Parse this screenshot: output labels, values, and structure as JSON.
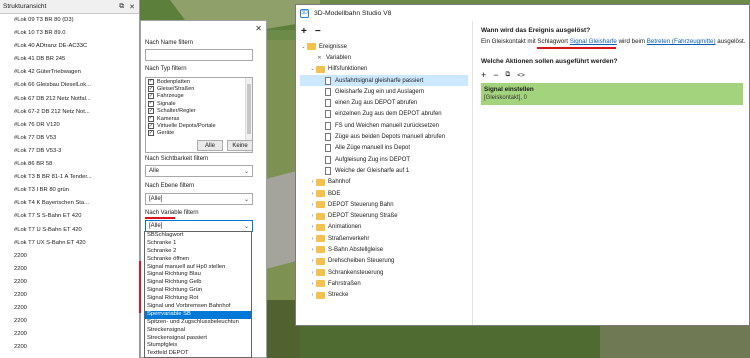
{
  "struct": {
    "title": "Strukturansicht",
    "items": [
      "#Lok 09 T3 BR 80 (D3)",
      "#Lok 10 T3 BR 89.0",
      "#Lok 40 ADtranz DE-AC33C",
      "#Lok 41 DB BR 245",
      "#Lok 42 GüterTriebwagen",
      "#Lok 66 Gleisbau DieselLok...",
      "#Lok 67 DB 212 Netz Notfal...",
      "#Lok 67-2 DB 212 Netz Not...",
      "#Lok 76 DR V120",
      "#Lok 77 DB V53",
      "#Lok 77 DB V53-3",
      "#Lok 86 BR 58",
      "#Lok T3 B BR 81-1 A Tender...",
      "#Lok T3 I BR 80 grün",
      "#Lok T4 K   Bayerischen Sta...",
      "#Lok T7 S S-Bahn ET 420",
      "#Lok T7 U S-Bahn ET 420",
      "#Lok T7 UX S-Bahn ET 420",
      "2200",
      "2200",
      "2200",
      "2200",
      "2200",
      "2200",
      "2200",
      "2200"
    ]
  },
  "filter": {
    "name_label": "Nach Name filtern",
    "name_value": "",
    "type_label": "Nach Typ filtern",
    "types": [
      "Bodenplatten",
      "Gleise/Straßen",
      "Fahrzeuge",
      "Signale",
      "Schalter/Regler",
      "Kameras",
      "Virtuelle Depots/Portale",
      "Geräte"
    ],
    "all_button": "Alle",
    "none_button": "Keine",
    "visibility_label": "Nach Sichtbarkeit filtern",
    "visibility_value": "Alle",
    "layer_label": "Nach Ebene filtern",
    "layer_value": "[Alle]",
    "variable_label": "Nach Variable filtern",
    "variable_value": "[Alle]",
    "variable_options": [
      "SBSchlagwort",
      "Schranke 1",
      "Schranke 2",
      "Schranke öffnen",
      "Signal manuell auf Hp0 stellen",
      "Signal Richtung Blau",
      "Signal Richtung Gelb",
      "Signal Richtung Grün",
      "Signal Richtung Rot",
      "Signal und Vorbremsen Bahnhof",
      "Sperrvariable SB",
      "Spitzen- und Zugschlussbeleuchtun",
      "Streckensignal",
      "Streckensignal passiert",
      "Stumpfgleis",
      "Textfeld DEPOT"
    ],
    "highlighted_option": "Sperrvariable SB"
  },
  "main": {
    "title": "3D-Modellbahn Studio V8",
    "tree": [
      {
        "label": "Ereignisse",
        "kind": "folder",
        "depth": 0,
        "expanded": true
      },
      {
        "label": "Variablen",
        "kind": "var",
        "depth": 1
      },
      {
        "label": "Hilfsfunktionen",
        "kind": "folder",
        "depth": 1,
        "expanded": true
      },
      {
        "label": "Ausfahrtsignal gleisharfe passiert",
        "kind": "doc",
        "depth": 2,
        "selected": true
      },
      {
        "label": "Gleisharfe Zug ein und Auslagern",
        "kind": "doc",
        "depth": 2
      },
      {
        "label": "einen Zug aus DEPOT abrufen",
        "kind": "doc",
        "depth": 2
      },
      {
        "label": "einzelnen Zug aus dem DEPOT abrufen",
        "kind": "doc",
        "depth": 2
      },
      {
        "label": "FS und Weichen manuell zurücksetzen",
        "kind": "doc",
        "depth": 2
      },
      {
        "label": "Züge aus beiden Depots manuell abrufen",
        "kind": "doc",
        "depth": 2
      },
      {
        "label": "Alle Züge manuell ins Depot",
        "kind": "doc",
        "depth": 2
      },
      {
        "label": "Aufgleisung Zug ins DEPOT",
        "kind": "doc",
        "depth": 2
      },
      {
        "label": "Weiche der Gleisharfe auf 1",
        "kind": "doc",
        "depth": 2
      },
      {
        "label": "Bahnhof",
        "kind": "folder",
        "depth": 1
      },
      {
        "label": "BDE",
        "kind": "folder",
        "depth": 1
      },
      {
        "label": "DEPOT Steuerung Bahn",
        "kind": "folder",
        "depth": 1
      },
      {
        "label": "DEPOT Steuerung Straße",
        "kind": "folder",
        "depth": 1
      },
      {
        "label": "Animationen",
        "kind": "folder",
        "depth": 1
      },
      {
        "label": "Straßenverkehr",
        "kind": "folder",
        "depth": 1
      },
      {
        "label": "S-Bahn Abstellgleise",
        "kind": "folder",
        "depth": 1
      },
      {
        "label": "Drehscheiben Steuerung",
        "kind": "folder",
        "depth": 1
      },
      {
        "label": "Schrankensteuerung",
        "kind": "folder",
        "depth": 1
      },
      {
        "label": "Fahrstraßen",
        "kind": "folder",
        "depth": 1
      },
      {
        "label": "Strecke",
        "kind": "folder",
        "depth": 1
      }
    ],
    "question1": "Wann wird das Ereignis ausgelöst?",
    "desc": {
      "pre": "Ein Gleiskontakt mit Schlagwort ",
      "link1": "Signal Gleisharfe",
      "mid": " wird beim ",
      "link2": "Betreten (Fahrzeugmitte)",
      "post": " ausgelöst."
    },
    "question2": "Welche Aktionen sollen ausgeführt werden?",
    "action": {
      "title": "Signal einstellen",
      "subtitle": "[Gleiskontakt], 0"
    },
    "colors": {
      "action_bg": "#a4d37e",
      "selection": "#0078d7",
      "annotation_red": "#d9141b",
      "link": "#0b5fb5"
    }
  }
}
